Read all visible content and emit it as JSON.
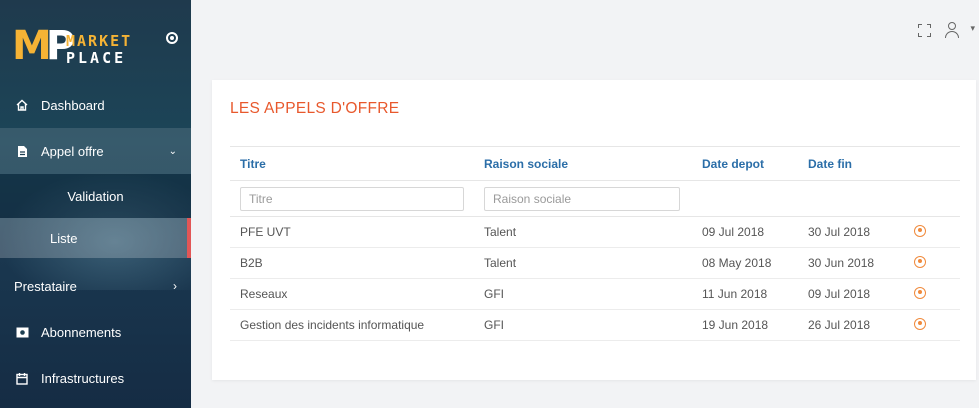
{
  "brand": {
    "mark_m": "M",
    "mark_p": "P",
    "line1": "MARKET",
    "line2": "PLACE"
  },
  "sidebar": {
    "items": [
      {
        "label": "Dashboard",
        "icon": "home-icon"
      },
      {
        "label": "Appel offre",
        "icon": "document-icon",
        "expanded": true
      },
      {
        "label": "Validation"
      },
      {
        "label": "Liste",
        "active": true
      },
      {
        "label": "Prestataire"
      },
      {
        "label": "Abonnements",
        "icon": "subscription-icon"
      },
      {
        "label": "Infrastructures",
        "icon": "calendar-icon"
      }
    ]
  },
  "page": {
    "title": "LES APPELS D'OFFRE"
  },
  "table": {
    "columns": [
      "Titre",
      "Raison sociale",
      "Date depot",
      "Date fin"
    ],
    "filters": {
      "titre_placeholder": "Titre",
      "raison_placeholder": "Raison sociale"
    },
    "rows": [
      {
        "titre": "PFE UVT",
        "raison": "Talent",
        "depot": "09 Jul 2018",
        "fin": "30 Jul 2018"
      },
      {
        "titre": "B2B",
        "raison": "Talent",
        "depot": "08 May 2018",
        "fin": "30 Jun 2018"
      },
      {
        "titre": "Reseaux",
        "raison": "GFI",
        "depot": "11 Jun 2018",
        "fin": "09 Jul 2018"
      },
      {
        "titre": "Gestion des incidents informatique",
        "raison": "GFI",
        "depot": "19 Jun 2018",
        "fin": "26 Jul 2018"
      }
    ]
  },
  "colors": {
    "accent": "#e8582c",
    "header_link": "#2b6ea8",
    "active_marker": "#e25656",
    "eye": "#f08a3c"
  }
}
